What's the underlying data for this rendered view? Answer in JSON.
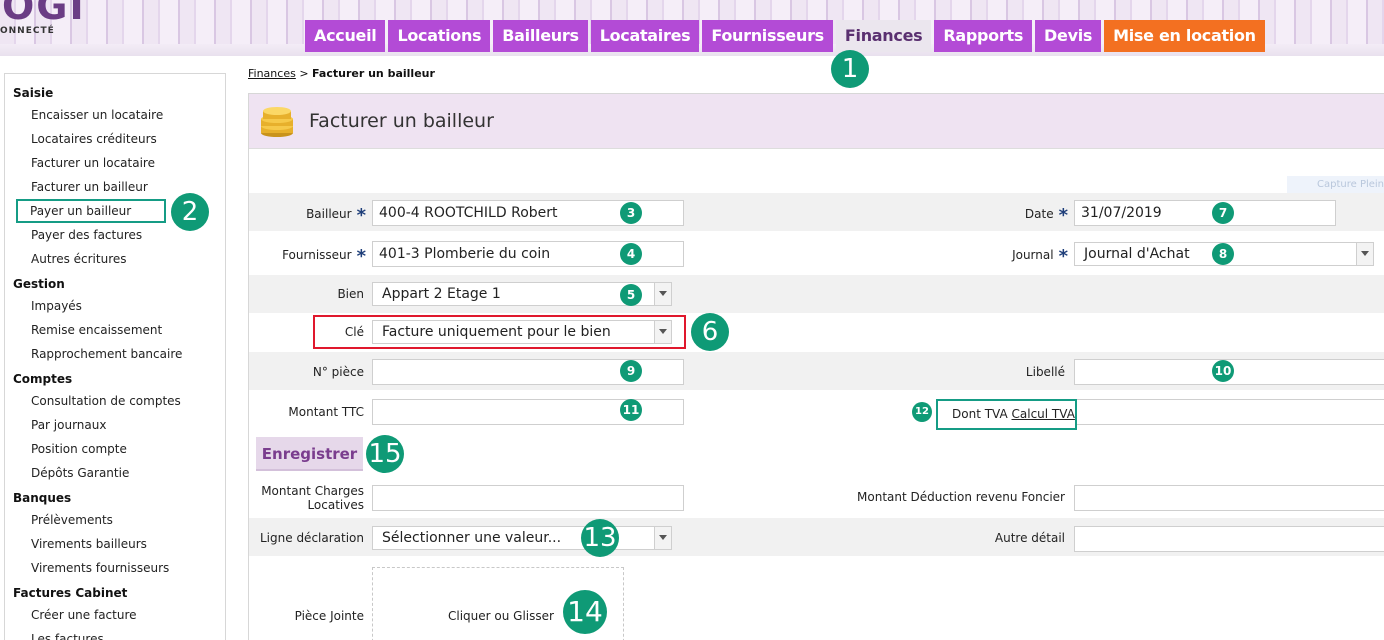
{
  "header": {
    "logo_text": "OGI",
    "logo_sub": "ONNECTÉ"
  },
  "nav": {
    "tabs": [
      {
        "label": "Accueil"
      },
      {
        "label": "Locations"
      },
      {
        "label": "Bailleurs"
      },
      {
        "label": "Locataires"
      },
      {
        "label": "Fournisseurs"
      },
      {
        "label": "Finances",
        "active": true
      },
      {
        "label": "Rapports"
      },
      {
        "label": "Devis"
      },
      {
        "label": "Mise en location"
      }
    ]
  },
  "sidebar": {
    "groups": [
      {
        "title": "Saisie",
        "items": [
          "Encaisser un locataire",
          "Locataires créditeurs",
          "Facturer un locataire",
          "Facturer un bailleur",
          "Payer un bailleur",
          "Payer des factures",
          "Autres écritures"
        ]
      },
      {
        "title": "Gestion",
        "items": [
          "Impayés",
          "Remise encaissement",
          "Rapprochement bancaire"
        ]
      },
      {
        "title": "Comptes",
        "items": [
          "Consultation de comptes",
          "Par journaux",
          "Position compte",
          "Dépôts Garantie"
        ]
      },
      {
        "title": "Banques",
        "items": [
          "Prélèvements",
          "Virements bailleurs",
          "Virements fournisseurs"
        ]
      },
      {
        "title": "Factures Cabinet",
        "items": [
          "Créer une facture",
          "Les factures"
        ]
      }
    ]
  },
  "breadcrumb": {
    "parent": "Finances",
    "separator": ">",
    "current": "Facturer un bailleur"
  },
  "page": {
    "title": "Facturer un bailleur",
    "capture_label": "Capture Plein"
  },
  "form": {
    "bailleur": {
      "label": "Bailleur",
      "value": "400-4 ROOTCHILD Robert"
    },
    "fournisseur": {
      "label": "Fournisseur",
      "value": "401-3 Plomberie du coin"
    },
    "bien": {
      "label": "Bien",
      "value": "Appart 2 Etage 1"
    },
    "cle": {
      "label": "Clé",
      "value": "Facture uniquement pour le bien"
    },
    "n_piece": {
      "label": "N° pièce",
      "value": ""
    },
    "montant_ttc": {
      "label": "Montant TTC",
      "value": ""
    },
    "date": {
      "label": "Date",
      "value": "31/07/2019"
    },
    "journal": {
      "label": "Journal",
      "value": "Journal d'Achat"
    },
    "libelle": {
      "label": "Libellé",
      "value": ""
    },
    "dont_tva": {
      "label": "Dont TVA",
      "link": "Calcul TVA"
    },
    "required_mark": "*",
    "save_label": "Enregistrer",
    "montant_charges": {
      "label_line1": "Montant Charges",
      "label_line2": "Locatives",
      "value": ""
    },
    "deduction": {
      "label": "Montant Déduction revenu Foncier",
      "value": ""
    },
    "ligne_declaration": {
      "label": "Ligne déclaration",
      "value": "Sélectionner une valeur..."
    },
    "autre_detail": {
      "label": "Autre détail",
      "value": ""
    },
    "piece_jointe": {
      "label": "Pièce Jointe",
      "dropzone_text": "Cliquer ou Glisser"
    }
  },
  "badges": [
    "1",
    "2",
    "3",
    "4",
    "5",
    "6",
    "7",
    "8",
    "9",
    "10",
    "11",
    "12",
    "13",
    "14",
    "15"
  ],
  "colors": {
    "nav_tab": "#b34bd6",
    "nav_tab_active": "#ebe6ee",
    "nav_tab_orange": "#f37021",
    "badge": "#0f9a76",
    "highlight_red": "#e0182d",
    "highlight_teal": "#159c85",
    "panel_header": "#efe3f2"
  }
}
